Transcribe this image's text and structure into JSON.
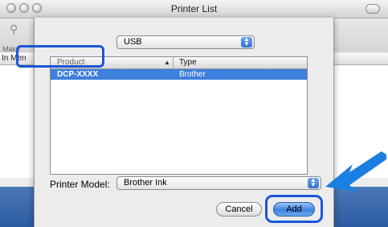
{
  "window": {
    "title": "Printer List"
  },
  "toolbar": {
    "make_label": "Make"
  },
  "list_header": {
    "first_column": "In Men"
  },
  "dialog": {
    "connection_popup": {
      "value": "USB"
    },
    "table": {
      "columns": [
        "Product",
        "Type"
      ],
      "rows": [
        {
          "product": "DCP-XXXX",
          "type": "Brother"
        }
      ]
    },
    "printer_model": {
      "label": "Printer Model:",
      "value": "Brother Ink"
    },
    "buttons": {
      "cancel": "Cancel",
      "add": "Add"
    }
  },
  "colors": {
    "highlight": "#1a56d8",
    "selection": "#3f7fdd",
    "arrow": "#1a7fe0"
  }
}
